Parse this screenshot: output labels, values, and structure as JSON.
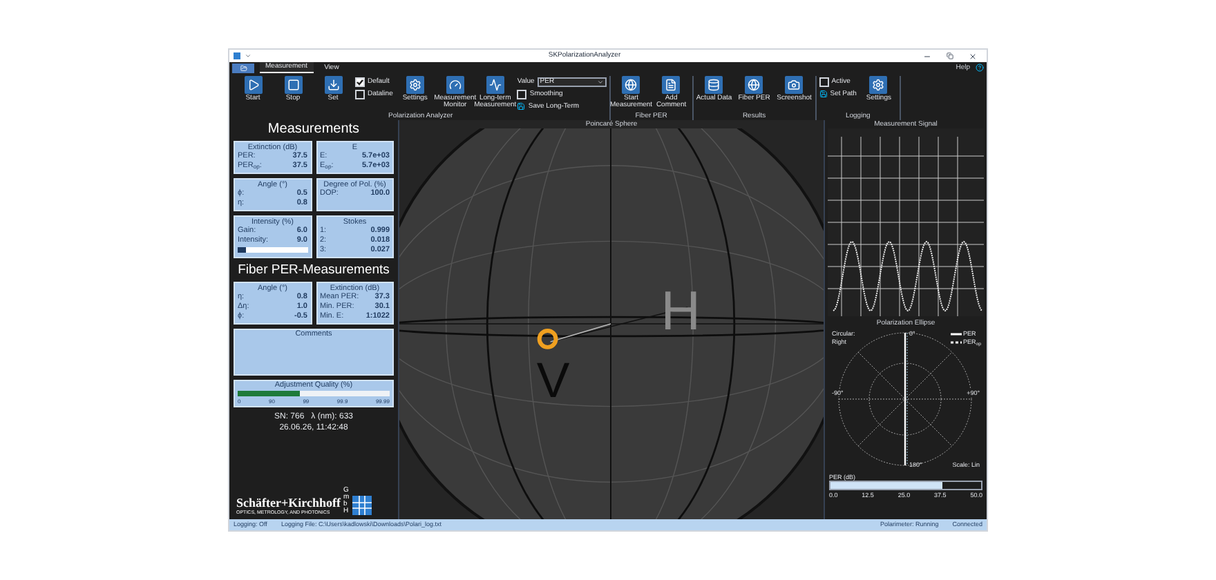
{
  "window": {
    "title": "SKPolarizationAnalyzer"
  },
  "ribbon_tabs": [
    {
      "label": "Measurement",
      "selected": true
    },
    {
      "label": "View",
      "selected": false
    }
  ],
  "help": "Help",
  "ribbon_groups": [
    {
      "label": "Polarization Analyzer",
      "items": [
        {
          "kind": "button",
          "label": "Start"
        },
        {
          "kind": "button",
          "label": "Stop"
        },
        {
          "kind": "button",
          "label": "Set"
        },
        {
          "kind": "stack",
          "entries": [
            {
              "kind": "checkbox",
              "label": "Default",
              "checked": true
            },
            {
              "kind": "checkbox",
              "label": "Dataline",
              "checked": false
            }
          ]
        },
        {
          "kind": "button",
          "label": "Settings"
        },
        {
          "kind": "button",
          "label": "Measurement Monitor"
        },
        {
          "kind": "button",
          "label": "Long-term Measurement"
        },
        {
          "kind": "stack",
          "entries": [
            {
              "kind": "select",
              "label": "Value",
              "value": "PER"
            },
            {
              "kind": "checkbox",
              "label": "Smoothing",
              "checked": false
            },
            {
              "kind": "small_button",
              "label": "Save Long-Term"
            }
          ]
        }
      ]
    },
    {
      "label": "Fiber PER",
      "items": [
        {
          "kind": "button",
          "label": "Start Measurement"
        },
        {
          "kind": "button",
          "label": "Add Comment"
        }
      ]
    },
    {
      "label": "Results",
      "items": [
        {
          "kind": "button",
          "label": "Actual Data"
        },
        {
          "kind": "button",
          "label": "Fiber PER"
        },
        {
          "kind": "button",
          "label": "Screenshot"
        }
      ]
    },
    {
      "label": "Logging",
      "items": [
        {
          "kind": "stack",
          "entries": [
            {
              "kind": "checkbox",
              "label": "Active",
              "checked": false
            },
            {
              "kind": "small_button",
              "label": "Set Path"
            }
          ]
        },
        {
          "kind": "button",
          "label": "Settings"
        }
      ]
    }
  ],
  "measurements": {
    "title": "Measurements",
    "cards": [
      {
        "title": "Extinction (dB)",
        "rows": [
          {
            "label": "PER:",
            "value": "37.5"
          },
          {
            "label": "PER$_{op}$:",
            "value": "37.5"
          }
        ]
      },
      {
        "title": "E",
        "rows": [
          {
            "label": "E:",
            "value": "5.7e+03"
          },
          {
            "label": "E$_{op}$:",
            "value": "5.7e+03"
          }
        ]
      },
      {
        "title": "Angle (°)",
        "rows": [
          {
            "label": "ϕ:",
            "value": "0.5"
          },
          {
            "label": "η:",
            "value": "0.8"
          }
        ]
      },
      {
        "title": "Degree of Pol. (%)",
        "rows": [
          {
            "label": "DOP:",
            "value": "100.0"
          }
        ]
      },
      {
        "title": "Intensity (%)",
        "rows": [
          {
            "label": "Gain:",
            "value": "6.0"
          },
          {
            "label": "Intensity:",
            "value": "9.0"
          }
        ],
        "level": 0.12
      },
      {
        "title": "Stokes",
        "rows": [
          {
            "label": "1:",
            "value": "0.999"
          },
          {
            "label": "2:",
            "value": "0.018"
          },
          {
            "label": "3:",
            "value": "0.027"
          }
        ]
      }
    ]
  },
  "fiber": {
    "title": "Fiber PER-Measurements",
    "cards": [
      {
        "title": "Angle (°)",
        "rows": [
          {
            "label": "η:",
            "value": "0.8"
          },
          {
            "label": "Δη:",
            "value": "1.0"
          },
          {
            "label": "ϕ:",
            "value": "-0.5"
          }
        ]
      },
      {
        "title": "Extinction (dB)",
        "rows": [
          {
            "label": "Mean PER:",
            "value": "37.3"
          },
          {
            "label": "Min. PER:",
            "value": "30.1"
          },
          {
            "label": "Min. E:",
            "value": "1:1022"
          }
        ]
      }
    ]
  },
  "comments": {
    "title": "Comments"
  },
  "adjustment": {
    "title": "Adjustment Quality (%)",
    "level": 0.41,
    "ticks": [
      "0",
      "90",
      "99",
      "99.9",
      "99.99"
    ]
  },
  "device_info": [
    "SN: 766   λ (nm): 633",
    "26.06.26, 11:42:48"
  ],
  "logo": {
    "name": "Schäfter+Kirchhoff",
    "tagline": "OPTICS, METROLOGY, AND PHOTONICS",
    "suffix": "GmbH"
  },
  "sphere": {
    "title": "Poincaré Sphere",
    "labels": [
      "H",
      "V"
    ]
  },
  "signal": {
    "title": "Measurement Signal"
  },
  "ellipse": {
    "title": "Polarization Ellipse",
    "direction": "Circular: Right",
    "angles": [
      "0°",
      "180°",
      "-90°",
      "+90°"
    ],
    "legend": [
      {
        "label": "PER",
        "kind": "solid"
      },
      {
        "label": "PER$_{op}$",
        "kind": "dashed"
      }
    ],
    "scale": "Scale: Lin"
  },
  "per_bar": {
    "title": "PER (dB)",
    "level": 0.746,
    "ticks": [
      "0.0",
      "12.5",
      "25.0",
      "37.5",
      "50.0"
    ]
  },
  "status_bar": {
    "left": [
      "Logging: Off",
      "Logging File: C:\\Users\\kadlowski\\Downloads\\Polari_log.txt"
    ],
    "right": [
      "Polarimeter: Running",
      "Connected"
    ]
  }
}
